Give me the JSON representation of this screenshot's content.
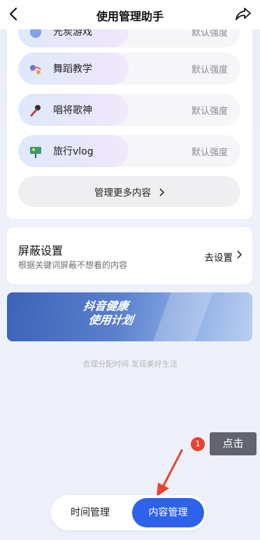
{
  "header": {
    "title": "使用管理助手",
    "back_icon": "chevron-left-icon",
    "share_icon": "share-arrow-icon"
  },
  "content_list": {
    "items": [
      {
        "label": "光炭游戏",
        "value": "默认强度",
        "icon": "game-icon"
      },
      {
        "label": "舞蹈教学",
        "value": "默认强度",
        "icon": "dance-icon"
      },
      {
        "label": "唱将歌神",
        "value": "默认强度",
        "icon": "microphone-icon"
      },
      {
        "label": "旅行vlog",
        "value": "默认强度",
        "icon": "travel-icon"
      }
    ],
    "more_label": "管理更多内容"
  },
  "block_settings": {
    "title": "屏蔽设置",
    "subtitle": "根据关键词屏蔽不想看的内容",
    "action": "去设置"
  },
  "banner": {
    "line1": "抖音健康",
    "line2": "使用计划"
  },
  "footnote": "合理分配时间 发现美好生活",
  "annotation": {
    "badge": "1",
    "tip": "点击"
  },
  "tabs": {
    "time": "时间管理",
    "content": "内容管理",
    "active_color": "#2f62ea"
  }
}
